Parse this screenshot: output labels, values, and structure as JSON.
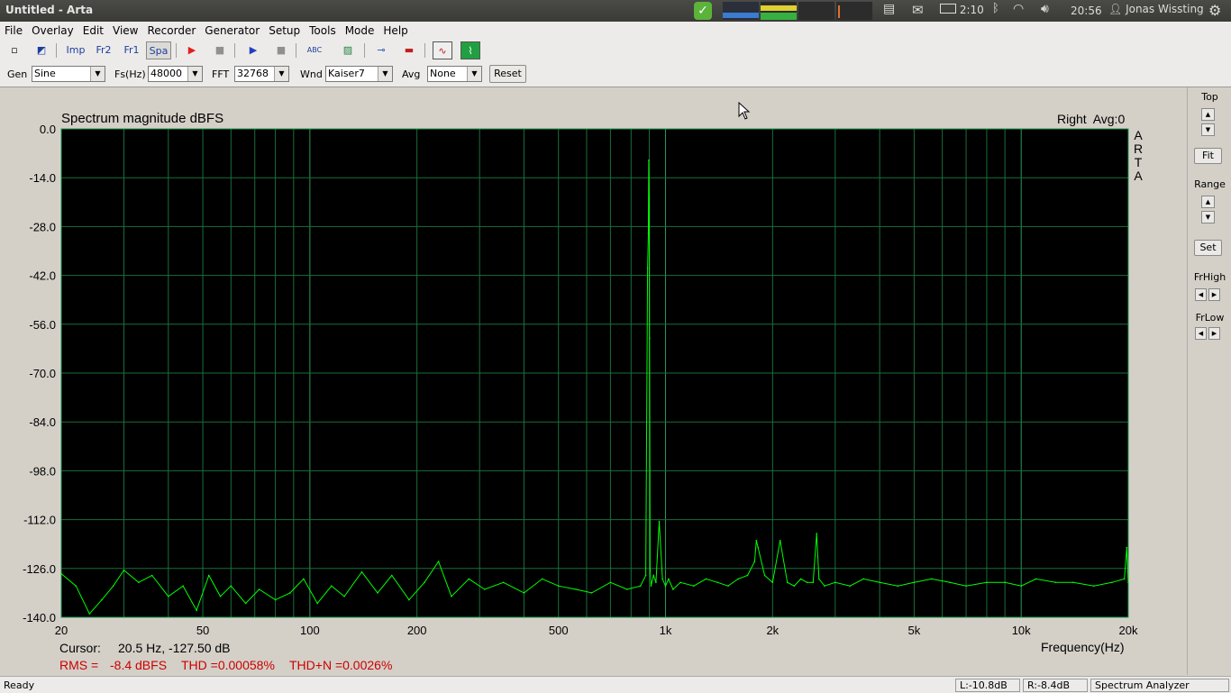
{
  "window": {
    "title": "Untitled - Arta"
  },
  "tray": {
    "battery": "2:10",
    "time": "20:56",
    "user": "Jonas Wissting"
  },
  "menu": [
    "File",
    "Overlay",
    "Edit",
    "View",
    "Recorder",
    "Generator",
    "Setup",
    "Tools",
    "Mode",
    "Help"
  ],
  "toolbar": {
    "buttons": [
      {
        "name": "new-file-icon",
        "label": "▫"
      },
      {
        "name": "open-file-icon",
        "label": "◩"
      },
      {
        "name": "impulse-mode-button",
        "label": "Imp"
      },
      {
        "name": "fr2-mode-button",
        "label": "Fr2"
      },
      {
        "name": "fr1-mode-button",
        "label": "Fr1"
      },
      {
        "name": "spa-mode-button",
        "label": "Spa"
      },
      {
        "name": "record-icon",
        "label": "▶"
      },
      {
        "name": "stop-record-icon",
        "label": "■"
      },
      {
        "name": "play-icon",
        "label": "▶"
      },
      {
        "name": "stop-icon",
        "label": "■"
      },
      {
        "name": "abc-icon",
        "label": "ABC"
      },
      {
        "name": "hatch-icon",
        "label": "▨"
      },
      {
        "name": "generator-icon",
        "label": "⊸"
      },
      {
        "name": "level-icon",
        "label": "▬"
      },
      {
        "name": "scope-icon",
        "label": "∿"
      },
      {
        "name": "spectrum-icon",
        "label": "⌇"
      }
    ]
  },
  "controls": {
    "gen_label": "Gen",
    "gen_value": "Sine",
    "fs_label": "Fs(Hz)",
    "fs_value": "48000",
    "fft_label": "FFT",
    "fft_value": "32768",
    "wnd_label": "Wnd",
    "wnd_value": "Kaiser7",
    "avg_label": "Avg",
    "avg_value": "None",
    "reset_label": "Reset"
  },
  "plot": {
    "title": "Spectrum magnitude dBFS",
    "channel_info": "Right  Avg:0",
    "brand": [
      "A",
      "R",
      "T",
      "A"
    ],
    "xlabel": "Frequency(Hz)",
    "cursor_label": "Cursor:",
    "cursor_value": "20.5 Hz, -127.50 dB",
    "rms_label": "RMS =",
    "rms_value": "-8.4 dBFS",
    "thd": "THD =0.00058%",
    "thdn": "THD+N =0.0026%"
  },
  "right_panel": {
    "top_label": "Top",
    "fit_label": "Fit",
    "range_label": "Range",
    "set_label": "Set",
    "frhigh_label": "FrHigh",
    "frlow_label": "FrLow"
  },
  "status": {
    "ready": "Ready",
    "left": "L:-10.8dB",
    "right": "R:-8.4dB",
    "mode": "Spectrum Analyzer"
  },
  "colors": {
    "plot_bg": "#000000",
    "trace": "#00ff00",
    "grid": "#1a6e3a",
    "readout": "#cc0000"
  },
  "chart_data": {
    "type": "line",
    "title": "Spectrum magnitude dBFS",
    "xlabel": "Frequency(Hz)",
    "ylabel": "",
    "xscale": "log",
    "xlim": [
      20,
      20000
    ],
    "ylim": [
      -140,
      0
    ],
    "grid": true,
    "yticks": [
      "0.0",
      "-14.0",
      "-28.0",
      "-42.0",
      "-56.0",
      "-70.0",
      "-84.0",
      "-98.0",
      "-112.0",
      "-126.0",
      "-140.0"
    ],
    "ytick_values": [
      0,
      -14,
      -28,
      -42,
      -56,
      -70,
      -84,
      -98,
      -112,
      -126,
      -140
    ],
    "xticks": [
      "20",
      "50",
      "100",
      "200",
      "500",
      "1k",
      "2k",
      "5k",
      "10k",
      "20k"
    ],
    "xtick_values": [
      20,
      50,
      100,
      200,
      500,
      1000,
      2000,
      5000,
      10000,
      20000
    ],
    "series": [
      {
        "x": [
          20,
          22,
          24,
          26,
          28,
          30,
          33,
          36,
          40,
          44,
          48,
          52,
          56,
          60,
          66,
          72,
          80,
          88,
          96,
          105,
          115,
          125,
          140,
          155,
          170,
          190,
          210,
          230,
          250,
          280,
          310,
          350,
          400,
          450,
          500,
          560,
          620,
          700,
          780,
          850,
          880,
          890,
          895,
          897,
          900,
          902,
          905,
          910,
          925,
          940,
          960,
          980,
          1000,
          1020,
          1050,
          1100,
          1200,
          1300,
          1400,
          1500,
          1600,
          1700,
          1780,
          1800,
          1820,
          1900,
          2000,
          2100,
          2200,
          2300,
          2400,
          2500,
          2600,
          2660,
          2700,
          2800,
          3000,
          3300,
          3600,
          4000,
          4500,
          5000,
          5600,
          6300,
          7000,
          8000,
          9000,
          10000,
          11000,
          12500,
          14000,
          16000,
          18000,
          19500,
          19800,
          20000
        ],
        "values": [
          -127.5,
          -131,
          -139,
          -135,
          -131,
          -126.5,
          -130,
          -128,
          -134,
          -131,
          -138,
          -128,
          -134,
          -131,
          -136,
          -132,
          -135,
          -133,
          -129,
          -136,
          -131,
          -134,
          -127,
          -133,
          -128,
          -135,
          -130,
          -124,
          -134,
          -129,
          -132,
          -130,
          -133,
          -129,
          -131,
          -132,
          -133,
          -130,
          -132,
          -131,
          -128,
          -40,
          -30,
          -9,
          -20,
          -60,
          -126,
          -131,
          -128,
          -130,
          -112.5,
          -129,
          -131,
          -129,
          -132,
          -130,
          -131,
          -129,
          -130,
          -131,
          -129,
          -128,
          -124,
          -118,
          -120,
          -128,
          -130,
          -118,
          -130,
          -131,
          -129,
          -130,
          -130,
          -116,
          -129,
          -131,
          -130,
          -131,
          -129,
          -130,
          -131,
          -130,
          -129,
          -130,
          -131,
          -130,
          -130,
          -131,
          -129,
          -130,
          -130,
          -131,
          -130,
          -129,
          -120,
          -130
        ]
      }
    ]
  }
}
